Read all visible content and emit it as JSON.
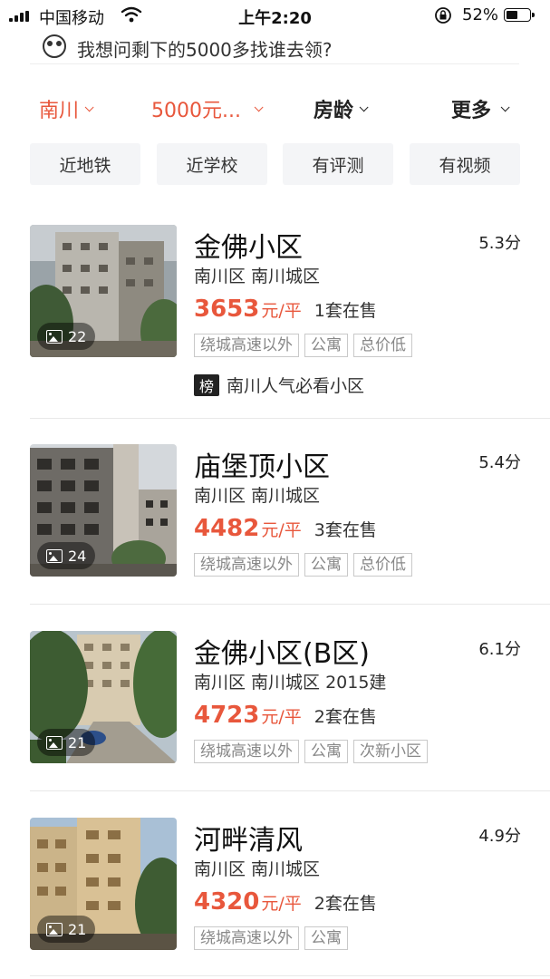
{
  "status_bar": {
    "carrier": "中国移动",
    "time": "上午2:20",
    "battery": "52%",
    "battery_level": 0.52
  },
  "banner": {
    "text": "我想问剩下的5000多找谁去领?"
  },
  "filters": [
    {
      "label": "南川",
      "active": true
    },
    {
      "label": "5000元...",
      "active": true
    },
    {
      "label": "房龄",
      "active": false
    },
    {
      "label": "更多",
      "active": false
    }
  ],
  "chips": [
    "近地铁",
    "近学校",
    "有评测",
    "有视频"
  ],
  "colors": {
    "accent": "#e8573c",
    "chip_bg": "#f4f5f7",
    "tag_border": "#c9c9c9"
  },
  "listings": [
    {
      "name": "金佛小区",
      "score": "5.3分",
      "location": "南川区 南川城区",
      "price": "3653",
      "unit": "元/平",
      "on_sale": "1套在售",
      "tags": [
        "绕城高速以外",
        "公寓",
        "总价低"
      ],
      "photo_count": "22",
      "rank_badge": "榜",
      "rank_text": "南川人气必看小区"
    },
    {
      "name": "庙堡顶小区",
      "score": "5.4分",
      "location": "南川区 南川城区",
      "price": "4482",
      "unit": "元/平",
      "on_sale": "3套在售",
      "tags": [
        "绕城高速以外",
        "公寓",
        "总价低"
      ],
      "photo_count": "24"
    },
    {
      "name": "金佛小区(B区)",
      "score": "6.1分",
      "location": "南川区 南川城区 2015建",
      "price": "4723",
      "unit": "元/平",
      "on_sale": "2套在售",
      "tags": [
        "绕城高速以外",
        "公寓",
        "次新小区"
      ],
      "photo_count": "21"
    },
    {
      "name": "河畔清风",
      "score": "4.9分",
      "location": "南川区 南川城区",
      "price": "4320",
      "unit": "元/平",
      "on_sale": "2套在售",
      "tags": [
        "绕城高速以外",
        "公寓"
      ],
      "photo_count": "21"
    }
  ]
}
